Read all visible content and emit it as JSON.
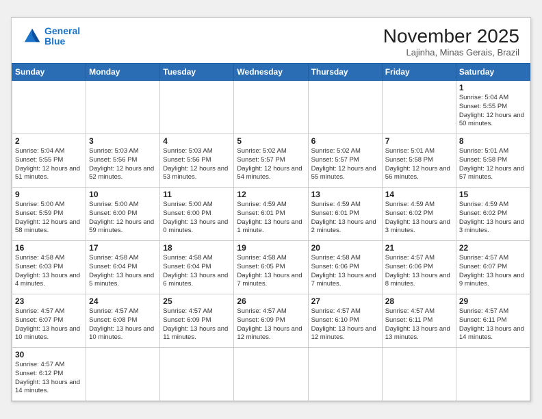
{
  "header": {
    "logo_line1": "General",
    "logo_line2": "Blue",
    "month_title": "November 2025",
    "location": "Lajinha, Minas Gerais, Brazil"
  },
  "weekdays": [
    "Sunday",
    "Monday",
    "Tuesday",
    "Wednesday",
    "Thursday",
    "Friday",
    "Saturday"
  ],
  "weeks": [
    [
      {
        "day": "",
        "info": ""
      },
      {
        "day": "",
        "info": ""
      },
      {
        "day": "",
        "info": ""
      },
      {
        "day": "",
        "info": ""
      },
      {
        "day": "",
        "info": ""
      },
      {
        "day": "",
        "info": ""
      },
      {
        "day": "1",
        "info": "Sunrise: 5:04 AM\nSunset: 5:55 PM\nDaylight: 12 hours and 50 minutes."
      }
    ],
    [
      {
        "day": "2",
        "info": "Sunrise: 5:04 AM\nSunset: 5:55 PM\nDaylight: 12 hours and 51 minutes."
      },
      {
        "day": "3",
        "info": "Sunrise: 5:03 AM\nSunset: 5:56 PM\nDaylight: 12 hours and 52 minutes."
      },
      {
        "day": "4",
        "info": "Sunrise: 5:03 AM\nSunset: 5:56 PM\nDaylight: 12 hours and 53 minutes."
      },
      {
        "day": "5",
        "info": "Sunrise: 5:02 AM\nSunset: 5:57 PM\nDaylight: 12 hours and 54 minutes."
      },
      {
        "day": "6",
        "info": "Sunrise: 5:02 AM\nSunset: 5:57 PM\nDaylight: 12 hours and 55 minutes."
      },
      {
        "day": "7",
        "info": "Sunrise: 5:01 AM\nSunset: 5:58 PM\nDaylight: 12 hours and 56 minutes."
      },
      {
        "day": "8",
        "info": "Sunrise: 5:01 AM\nSunset: 5:58 PM\nDaylight: 12 hours and 57 minutes."
      }
    ],
    [
      {
        "day": "9",
        "info": "Sunrise: 5:00 AM\nSunset: 5:59 PM\nDaylight: 12 hours and 58 minutes."
      },
      {
        "day": "10",
        "info": "Sunrise: 5:00 AM\nSunset: 6:00 PM\nDaylight: 12 hours and 59 minutes."
      },
      {
        "day": "11",
        "info": "Sunrise: 5:00 AM\nSunset: 6:00 PM\nDaylight: 13 hours and 0 minutes."
      },
      {
        "day": "12",
        "info": "Sunrise: 4:59 AM\nSunset: 6:01 PM\nDaylight: 13 hours and 1 minute."
      },
      {
        "day": "13",
        "info": "Sunrise: 4:59 AM\nSunset: 6:01 PM\nDaylight: 13 hours and 2 minutes."
      },
      {
        "day": "14",
        "info": "Sunrise: 4:59 AM\nSunset: 6:02 PM\nDaylight: 13 hours and 3 minutes."
      },
      {
        "day": "15",
        "info": "Sunrise: 4:59 AM\nSunset: 6:02 PM\nDaylight: 13 hours and 3 minutes."
      }
    ],
    [
      {
        "day": "16",
        "info": "Sunrise: 4:58 AM\nSunset: 6:03 PM\nDaylight: 13 hours and 4 minutes."
      },
      {
        "day": "17",
        "info": "Sunrise: 4:58 AM\nSunset: 6:04 PM\nDaylight: 13 hours and 5 minutes."
      },
      {
        "day": "18",
        "info": "Sunrise: 4:58 AM\nSunset: 6:04 PM\nDaylight: 13 hours and 6 minutes."
      },
      {
        "day": "19",
        "info": "Sunrise: 4:58 AM\nSunset: 6:05 PM\nDaylight: 13 hours and 7 minutes."
      },
      {
        "day": "20",
        "info": "Sunrise: 4:58 AM\nSunset: 6:06 PM\nDaylight: 13 hours and 7 minutes."
      },
      {
        "day": "21",
        "info": "Sunrise: 4:57 AM\nSunset: 6:06 PM\nDaylight: 13 hours and 8 minutes."
      },
      {
        "day": "22",
        "info": "Sunrise: 4:57 AM\nSunset: 6:07 PM\nDaylight: 13 hours and 9 minutes."
      }
    ],
    [
      {
        "day": "23",
        "info": "Sunrise: 4:57 AM\nSunset: 6:07 PM\nDaylight: 13 hours and 10 minutes."
      },
      {
        "day": "24",
        "info": "Sunrise: 4:57 AM\nSunset: 6:08 PM\nDaylight: 13 hours and 10 minutes."
      },
      {
        "day": "25",
        "info": "Sunrise: 4:57 AM\nSunset: 6:09 PM\nDaylight: 13 hours and 11 minutes."
      },
      {
        "day": "26",
        "info": "Sunrise: 4:57 AM\nSunset: 6:09 PM\nDaylight: 13 hours and 12 minutes."
      },
      {
        "day": "27",
        "info": "Sunrise: 4:57 AM\nSunset: 6:10 PM\nDaylight: 13 hours and 12 minutes."
      },
      {
        "day": "28",
        "info": "Sunrise: 4:57 AM\nSunset: 6:11 PM\nDaylight: 13 hours and 13 minutes."
      },
      {
        "day": "29",
        "info": "Sunrise: 4:57 AM\nSunset: 6:11 PM\nDaylight: 13 hours and 14 minutes."
      }
    ],
    [
      {
        "day": "30",
        "info": "Sunrise: 4:57 AM\nSunset: 6:12 PM\nDaylight: 13 hours and 14 minutes."
      },
      {
        "day": "",
        "info": ""
      },
      {
        "day": "",
        "info": ""
      },
      {
        "day": "",
        "info": ""
      },
      {
        "day": "",
        "info": ""
      },
      {
        "day": "",
        "info": ""
      },
      {
        "day": "",
        "info": ""
      }
    ]
  ]
}
